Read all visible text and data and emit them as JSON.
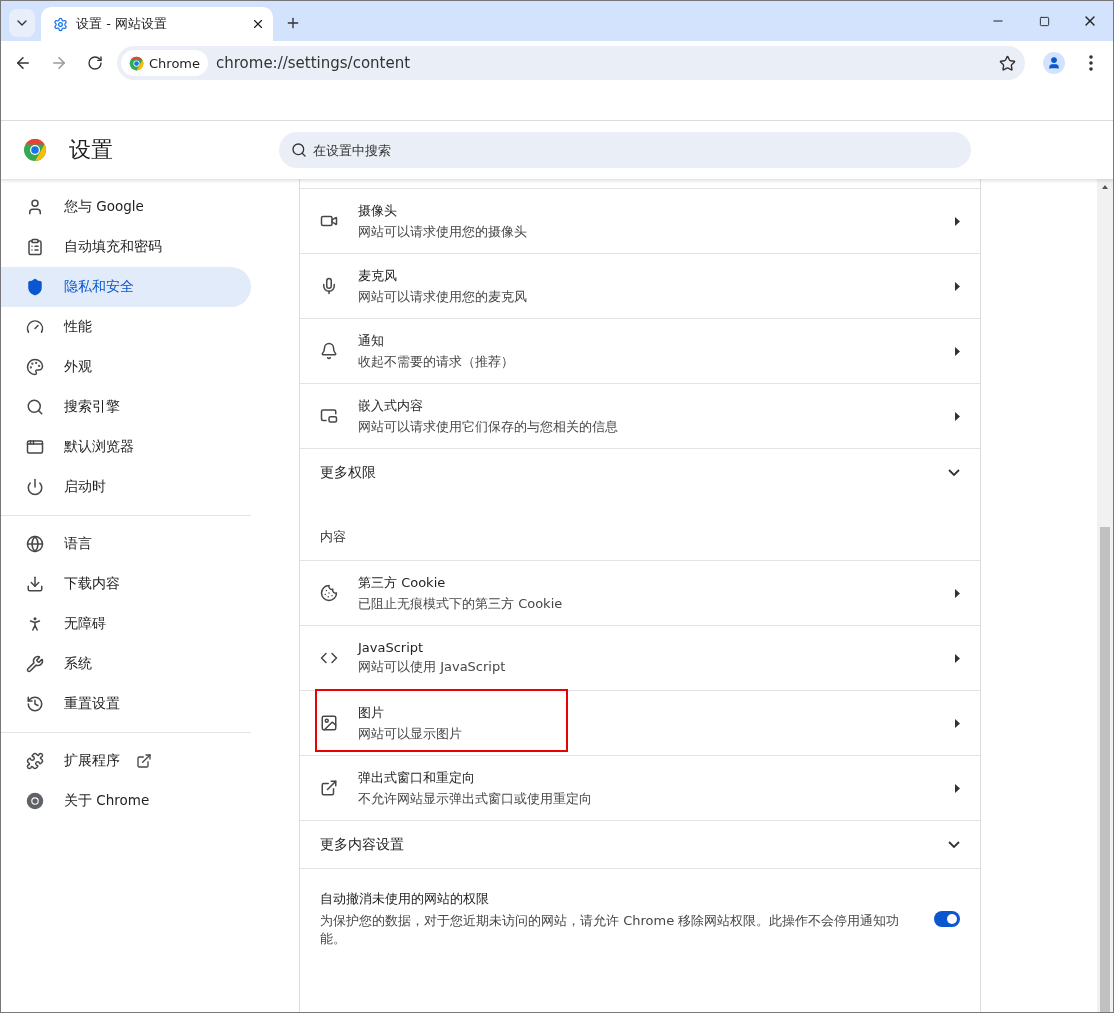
{
  "window": {
    "tab_title": "设置 - 网站设置"
  },
  "toolbar": {
    "site_chip": "Chrome",
    "url": "chrome://settings/content"
  },
  "header": {
    "title": "设置",
    "search": {
      "placeholder": "在设置中搜索"
    }
  },
  "sidebar": {
    "groups": [
      {
        "items": [
          {
            "label": "您与 Google",
            "selected": false,
            "external": false
          },
          {
            "label": "自动填充和密码",
            "selected": false,
            "external": false
          },
          {
            "label": "隐私和安全",
            "selected": true,
            "external": false
          },
          {
            "label": "性能",
            "selected": false,
            "external": false
          },
          {
            "label": "外观",
            "selected": false,
            "external": false
          },
          {
            "label": "搜索引擎",
            "selected": false,
            "external": false
          },
          {
            "label": "默认浏览器",
            "selected": false,
            "external": false
          },
          {
            "label": "启动时",
            "selected": false,
            "external": false
          }
        ]
      },
      {
        "items": [
          {
            "label": "语言",
            "selected": false,
            "external": false
          },
          {
            "label": "下载内容",
            "selected": false,
            "external": false
          },
          {
            "label": "无障碍",
            "selected": false,
            "external": false
          },
          {
            "label": "系统",
            "selected": false,
            "external": false
          },
          {
            "label": "重置设置",
            "selected": false,
            "external": false
          }
        ]
      },
      {
        "items": [
          {
            "label": "扩展程序",
            "selected": false,
            "external": true
          },
          {
            "label": "关于 Chrome",
            "selected": false,
            "external": false
          }
        ]
      }
    ]
  },
  "permissions": {
    "rows": [
      {
        "kind": "camera",
        "title": "摄像头",
        "subtitle": "网站可以请求使用您的摄像头",
        "highlighted": false
      },
      {
        "kind": "mic",
        "title": "麦克风",
        "subtitle": "网站可以请求使用您的麦克风",
        "highlighted": false
      },
      {
        "kind": "bell",
        "title": "通知",
        "subtitle": "收起不需要的请求（推荐）",
        "highlighted": false
      },
      {
        "kind": "embed",
        "title": "嵌入式内容",
        "subtitle": "网站可以请求使用它们保存的与您相关的信息",
        "highlighted": false
      }
    ],
    "more": {
      "label": "更多权限",
      "expanded": false
    }
  },
  "content": {
    "heading": "内容",
    "rows": [
      {
        "kind": "cookie",
        "title": "第三方 Cookie",
        "subtitle": "已阻止无痕模式下的第三方 Cookie",
        "highlighted": false
      },
      {
        "kind": "code",
        "title": "JavaScript",
        "subtitle": "网站可以使用 JavaScript",
        "highlighted": false
      },
      {
        "kind": "image",
        "title": "图片",
        "subtitle": "网站可以显示图片",
        "highlighted": true
      },
      {
        "kind": "popup",
        "title": "弹出式窗口和重定向",
        "subtitle": "不允许网站显示弹出式窗口或使用重定向",
        "highlighted": false
      }
    ],
    "more": {
      "label": "更多内容设置",
      "expanded": false
    },
    "auto_revoke": {
      "title": "自动撤消未使用的网站的权限",
      "description": "为保护您的数据，对于您近期未访问的网站，请允许 Chrome 移除网站权限。此操作不会停用通知功能。",
      "on": true
    }
  }
}
